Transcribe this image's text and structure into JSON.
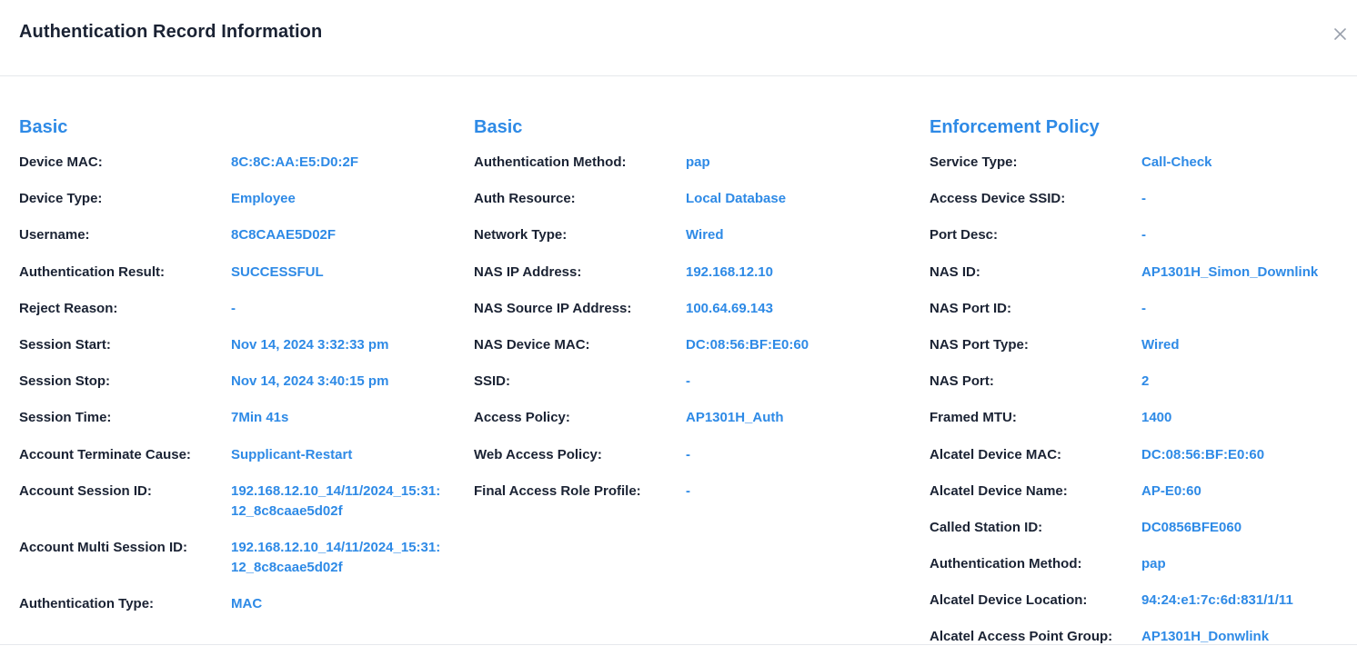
{
  "header": {
    "title": "Authentication Record Information",
    "close_icon": "close-icon"
  },
  "columns": [
    {
      "heading": "Basic",
      "rows": [
        {
          "label": "Device MAC:",
          "value": "8C:8C:AA:E5:D0:2F"
        },
        {
          "label": "Device Type:",
          "value": "Employee"
        },
        {
          "label": "Username:",
          "value": "8C8CAAE5D02F"
        },
        {
          "label": "Authentication Result:",
          "value": "SUCCESSFUL"
        },
        {
          "label": "Reject Reason:",
          "value": "-"
        },
        {
          "label": "Session Start:",
          "value": "Nov 14, 2024 3:32:33 pm"
        },
        {
          "label": "Session Stop:",
          "value": "Nov 14, 2024 3:40:15 pm"
        },
        {
          "label": "Session Time:",
          "value": "7Min 41s"
        },
        {
          "label": "Account Terminate Cause:",
          "value": "Supplicant-Restart"
        },
        {
          "label": "Account Session ID:",
          "value": "192.168.12.10_14/11/2024_15:31:12_8c8caae5d02f"
        },
        {
          "label": "Account Multi Session ID:",
          "value": "192.168.12.10_14/11/2024_15:31:12_8c8caae5d02f"
        },
        {
          "label": "Authentication Type:",
          "value": "MAC"
        }
      ]
    },
    {
      "heading": "Basic",
      "rows": [
        {
          "label": "Authentication Method:",
          "value": "pap"
        },
        {
          "label": "Auth Resource:",
          "value": "Local Database"
        },
        {
          "label": "Network Type:",
          "value": "Wired"
        },
        {
          "label": "NAS IP Address:",
          "value": "192.168.12.10"
        },
        {
          "label": "NAS Source IP Address:",
          "value": "100.64.69.143"
        },
        {
          "label": "NAS Device MAC:",
          "value": "DC:08:56:BF:E0:60"
        },
        {
          "label": "SSID:",
          "value": "-"
        },
        {
          "label": "Access Policy:",
          "value": "AP1301H_Auth"
        },
        {
          "label": "Web Access Policy:",
          "value": "-"
        },
        {
          "label": "Final Access Role Profile:",
          "value": "-"
        }
      ]
    },
    {
      "heading": "Enforcement Policy",
      "rows": [
        {
          "label": "Service Type:",
          "value": "Call-Check"
        },
        {
          "label": "Access Device SSID:",
          "value": "-"
        },
        {
          "label": "Port Desc:",
          "value": "-"
        },
        {
          "label": "NAS ID:",
          "value": "AP1301H_Simon_Downlink"
        },
        {
          "label": "NAS Port ID:",
          "value": "-"
        },
        {
          "label": "NAS Port Type:",
          "value": "Wired"
        },
        {
          "label": "NAS Port:",
          "value": "2"
        },
        {
          "label": "Framed MTU:",
          "value": "1400"
        },
        {
          "label": "Alcatel Device MAC:",
          "value": "DC:08:56:BF:E0:60"
        },
        {
          "label": "Alcatel Device Name:",
          "value": "AP-E0:60"
        },
        {
          "label": "Called Station ID:",
          "value": "DC0856BFE060"
        },
        {
          "label": "Authentication Method:",
          "value": "pap"
        },
        {
          "label": "Alcatel Device Location:",
          "value": "94:24:e1:7c:6d:831/1/11"
        },
        {
          "label": "Alcatel Access Point Group:",
          "value": "AP1301H_Donwlink"
        }
      ]
    }
  ],
  "colors": {
    "accent": "#2e8ae6",
    "text": "#1a2233",
    "divider": "#e6e8ec"
  }
}
